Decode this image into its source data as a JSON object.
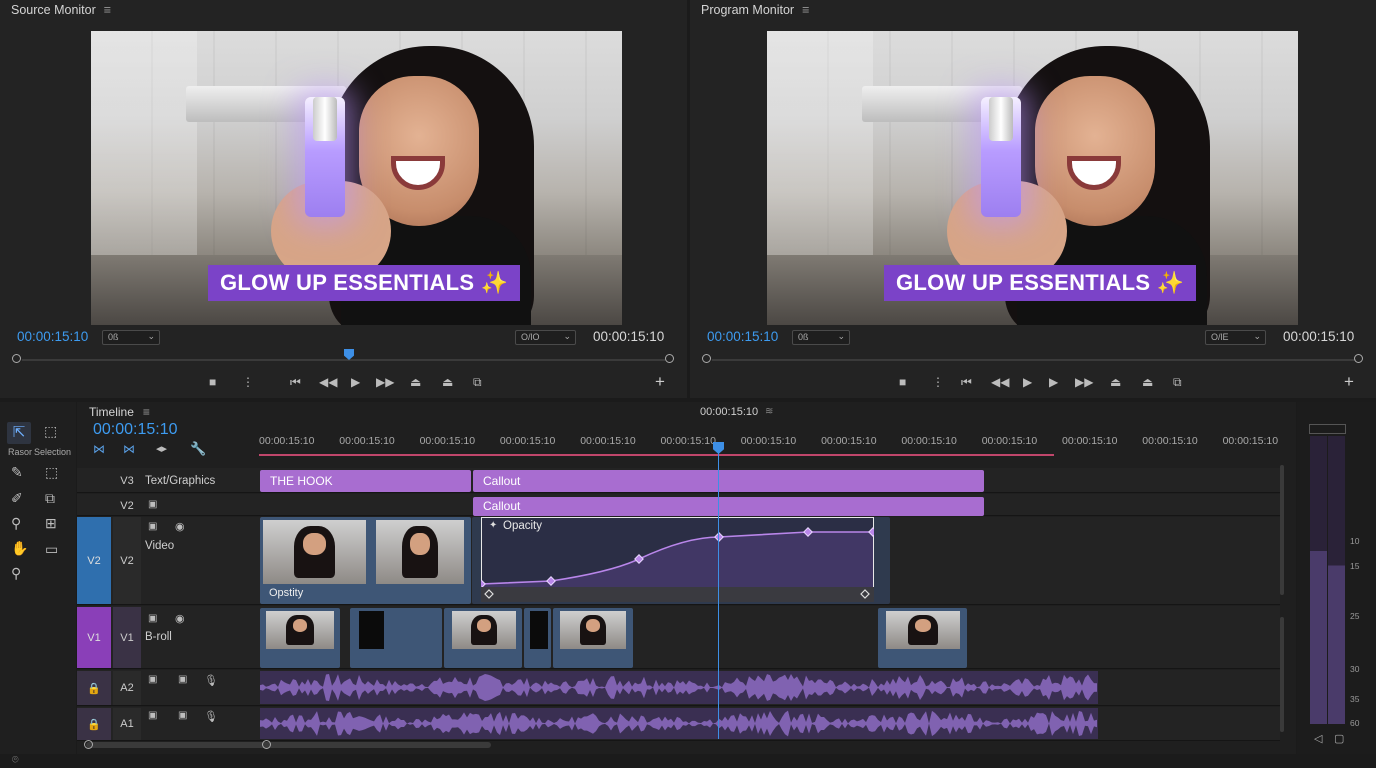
{
  "source_monitor": {
    "title": "Source Monitor",
    "menu_icon": "hamburger-icon",
    "caption": "GLOW UP ESSENTIALS ✨",
    "timecode_left": "00:00:15:10",
    "timecode_right": "00:00:15:10",
    "fit_dropdown": "0ß",
    "quality_dropdown": "O/lO"
  },
  "program_monitor": {
    "title": "Program Monitor",
    "menu_icon": "hamburger-icon",
    "caption": "GLOW UP ESSENTIALS ✨",
    "timecode_left": "00:00:15:10",
    "timecode_right": "00:00:15:10",
    "fit_dropdown": "0ß",
    "quality_dropdown": "O/lE"
  },
  "tools": {
    "razor_label": "Rasor",
    "selection_label": "Selection"
  },
  "timeline": {
    "title": "Timeline",
    "timecode": "00:00:15:10",
    "center_timecode": "00:00:15:10",
    "ruler_labels": [
      "00:00:15:10",
      "00:00:15:10",
      "00:00:15:10",
      "00:00:15:10",
      "00:00:15:10",
      "00:00:15:10",
      "00:00:15:10",
      "00:00:15:10",
      "00:00:15:10",
      "00:00:15:10",
      "00:00:15:10",
      "00:00:15:10",
      "00:00:15:10"
    ],
    "tracks": {
      "v3": {
        "target": "",
        "label": "V3",
        "name": "Text/Graphics"
      },
      "v2a": {
        "target": "",
        "label": "V2"
      },
      "v2": {
        "target": "V2",
        "label": "V2",
        "name": "Video"
      },
      "v1": {
        "target": "V1",
        "label": "V1",
        "name": "B-roll"
      },
      "a2": {
        "label": "A2"
      },
      "a1": {
        "label": "A1"
      }
    },
    "clips": {
      "hook": "THE HOOK",
      "callout_1": "Callout",
      "callout_2": "Callout",
      "opacity": "Opacity",
      "opacity_clip_label": "Opstity"
    }
  },
  "meter": {
    "scale": [
      "10",
      "15",
      "25",
      "30",
      "35",
      "60"
    ]
  },
  "colors": {
    "accent_blue": "#3d9bf0",
    "clip_purple": "#a86dd0",
    "caption_bg": "#7b43c8"
  }
}
